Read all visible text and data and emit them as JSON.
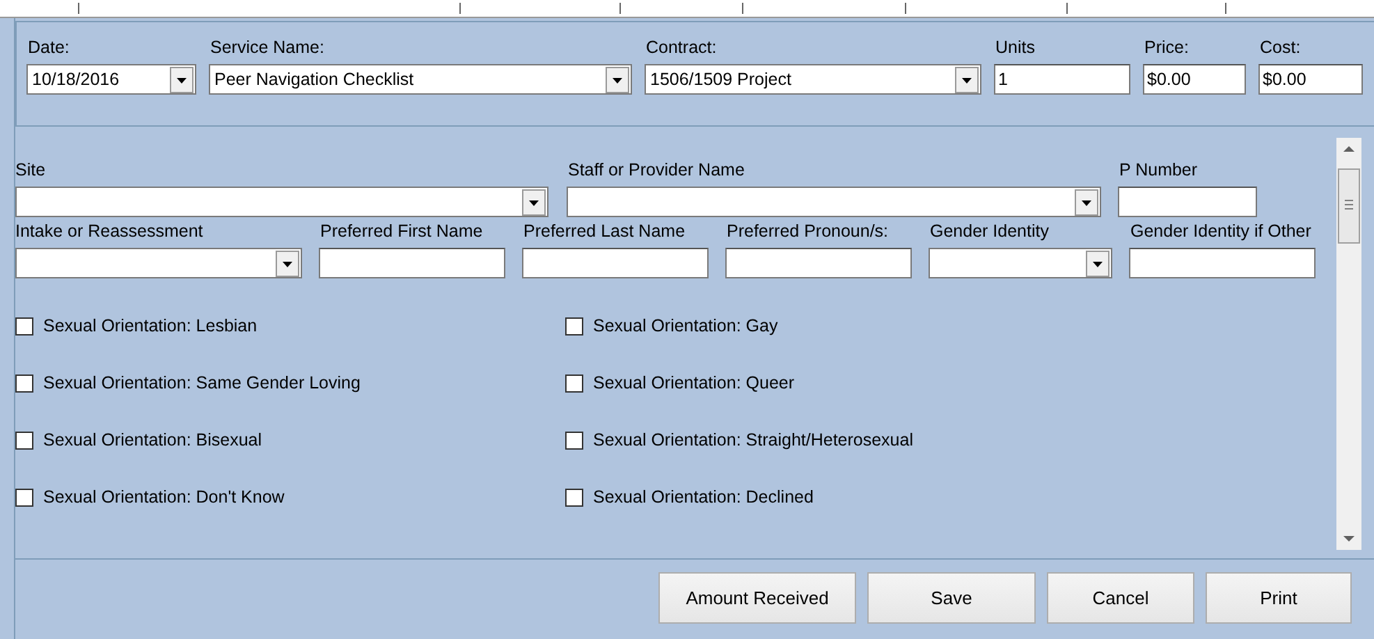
{
  "top_fields": [
    {
      "kind": "combo",
      "label": "Date:",
      "value": "10/18/2016"
    },
    {
      "kind": "combo",
      "label": "Service Name:",
      "value": "Peer Navigation Checklist"
    },
    {
      "kind": "combo",
      "label": "Contract:",
      "value": "1506/1509 Project"
    },
    {
      "kind": "text",
      "label": "Units",
      "value": "1"
    },
    {
      "kind": "text",
      "label": "Price:",
      "value": "$0.00"
    },
    {
      "kind": "text",
      "label": "Cost:",
      "value": "$0.00"
    }
  ],
  "form_rows": [
    [
      {
        "kind": "combo",
        "label": "Site"
      },
      {
        "kind": "combo",
        "label": "Staff or Provider Name"
      },
      {
        "kind": "text",
        "label": "P Number"
      }
    ],
    [
      {
        "kind": "combo",
        "label": "Intake or Reassessment"
      },
      {
        "kind": "text",
        "label": "Preferred First Name"
      },
      {
        "kind": "text",
        "label": "Preferred Last Name"
      },
      {
        "kind": "text",
        "label": "Preferred Pronoun/s:"
      },
      {
        "kind": "combo",
        "label": "Gender Identity"
      },
      {
        "kind": "text",
        "label": "Gender Identity if Other"
      }
    ]
  ],
  "checkboxes": [
    {
      "label": "Sexual Orientation: Lesbian",
      "checked": false
    },
    {
      "label": "Sexual Orientation: Gay",
      "checked": false
    },
    {
      "label": "Sexual Orientation: Same Gender Loving",
      "checked": false
    },
    {
      "label": "Sexual Orientation: Queer",
      "checked": false
    },
    {
      "label": "Sexual Orientation: Bisexual",
      "checked": false
    },
    {
      "label": "Sexual Orientation: Straight/Heterosexual",
      "checked": false
    },
    {
      "label": "Sexual Orientation: Don't Know",
      "checked": false
    },
    {
      "label": "Sexual Orientation: Declined",
      "checked": false
    }
  ],
  "buttons": [
    "Amount Received",
    "Save",
    "Cancel",
    "Print"
  ]
}
